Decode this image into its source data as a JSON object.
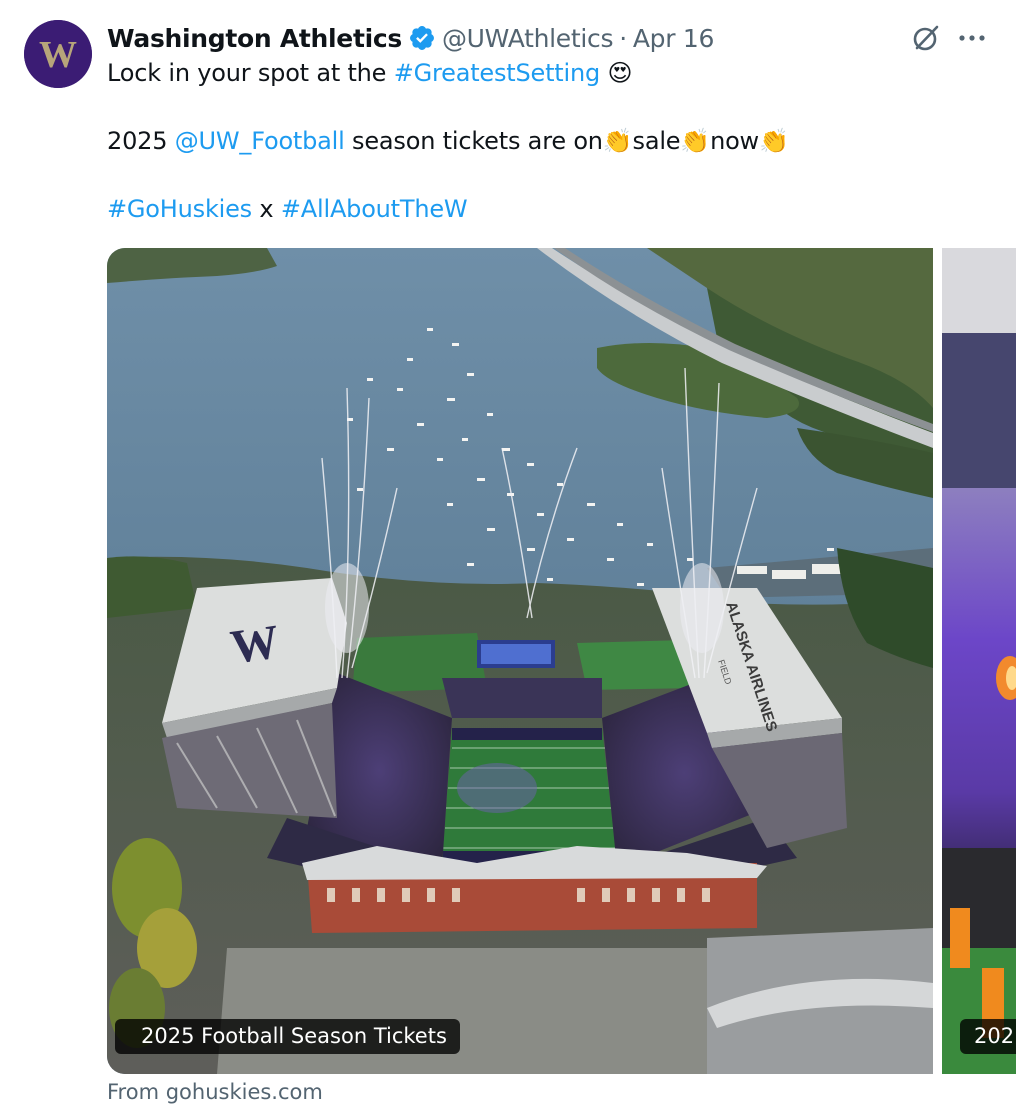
{
  "author": {
    "name": "Washington Athletics",
    "handle": "@UWAthletics",
    "separator": "·",
    "date": "Apr 16",
    "avatar_letter": "W",
    "verified": true
  },
  "tweet": {
    "line1": {
      "text": "Lock in your spot at the ",
      "hashtag": "#GreatestSetting",
      "emoji": "😍"
    },
    "line2": {
      "prefix": "2025 ",
      "mention": "@UW_Football",
      "text1": " season tickets are on",
      "clap1": "👏",
      "text2": "sale",
      "clap2": "👏",
      "text3": "now",
      "clap3": "👏"
    },
    "line3": {
      "hashtag1": "#GoHuskies",
      "sep": " x ",
      "hashtag2": "#AllAboutTheW"
    }
  },
  "card": {
    "caption": "2025 Football Season Tickets",
    "next_caption": "202",
    "stadium_logo": "W",
    "roof_text": "ALASKA AIRLINES",
    "roof_sub": "FIELD"
  },
  "source": "From gohuskies.com",
  "colors": {
    "link": "#1d9bf0",
    "secondary": "#536471",
    "husky_purple": "#3b1c74",
    "verified": "#1d9bf0"
  },
  "icons": [
    "verified-badge-icon",
    "grok-icon",
    "more-icon"
  ]
}
